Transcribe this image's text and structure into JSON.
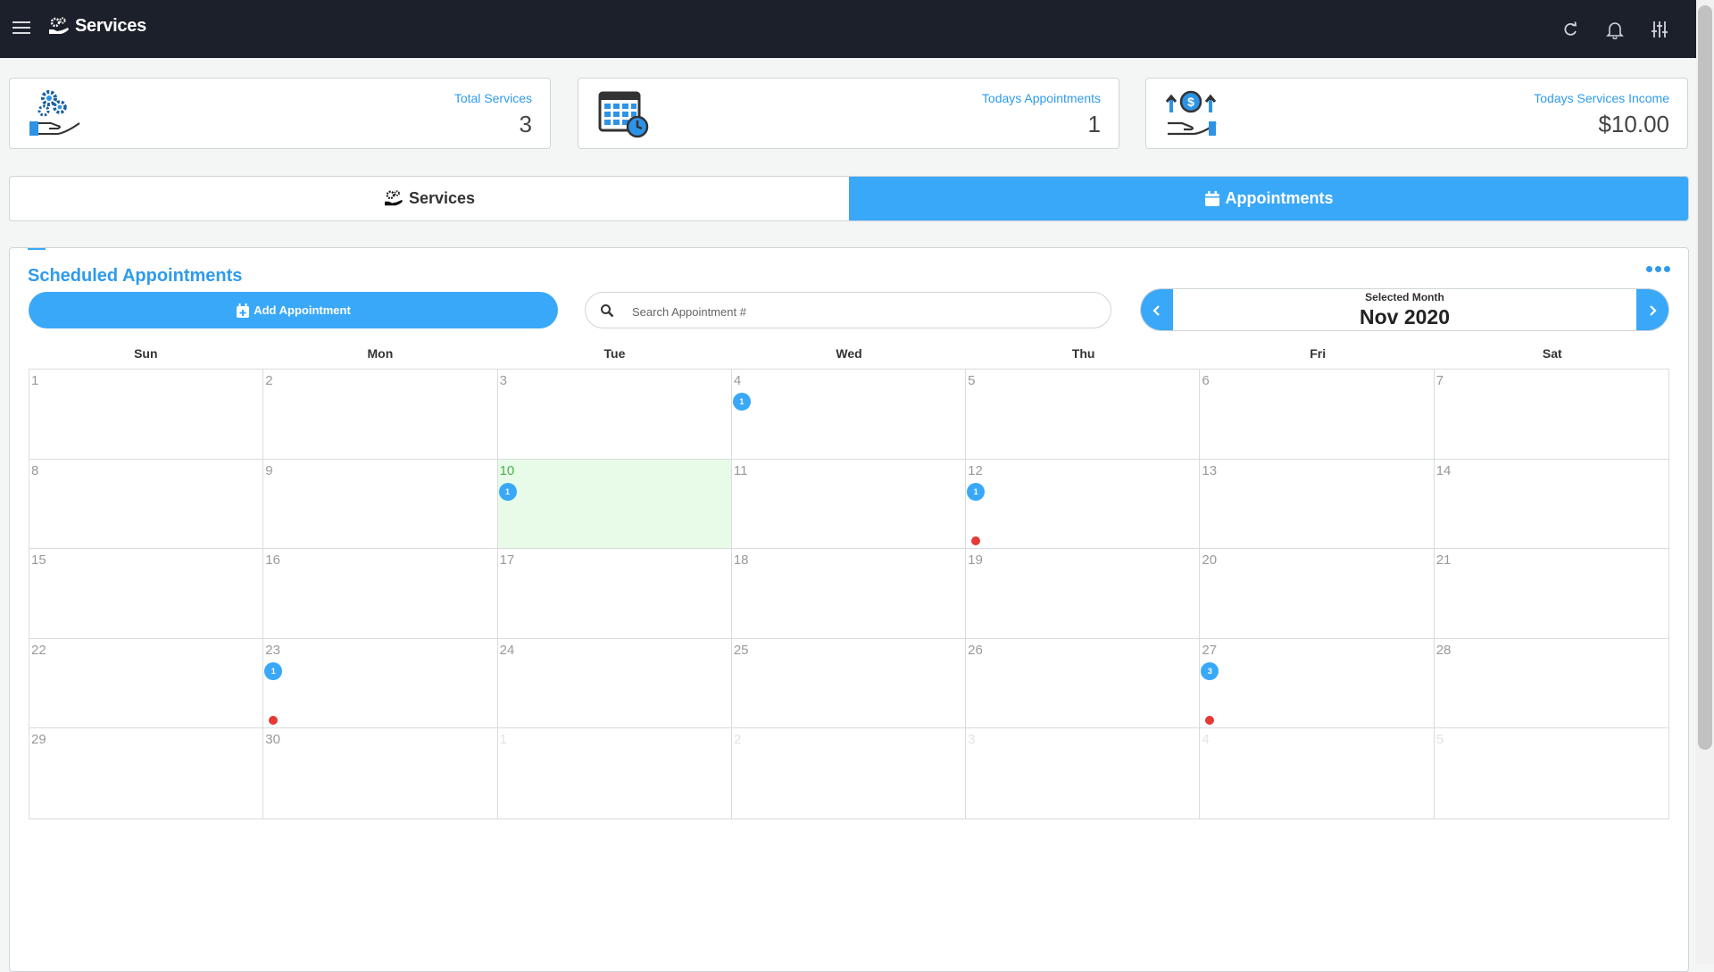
{
  "header": {
    "title": "Services"
  },
  "stats": [
    {
      "label": "Total Services",
      "value": "3"
    },
    {
      "label": "Todays Appointments",
      "value": "1"
    },
    {
      "label": "Todays Services Income",
      "value": "$10.00"
    }
  ],
  "tabs": [
    {
      "label": "Services",
      "active": false
    },
    {
      "label": "Appointments",
      "active": true
    }
  ],
  "appointments": {
    "title": "Scheduled Appointments",
    "add_label": "Add Appointment",
    "search_placeholder": "Search Appointment #",
    "search_value": "",
    "month_label": "Selected Month",
    "month_value": "Nov 2020"
  },
  "calendar": {
    "weekdays": [
      "Sun",
      "Mon",
      "Tue",
      "Wed",
      "Thu",
      "Fri",
      "Sat"
    ],
    "days": [
      {
        "d": "1"
      },
      {
        "d": "2"
      },
      {
        "d": "3"
      },
      {
        "d": "4",
        "count": "1"
      },
      {
        "d": "5"
      },
      {
        "d": "6"
      },
      {
        "d": "7"
      },
      {
        "d": "8"
      },
      {
        "d": "9"
      },
      {
        "d": "10",
        "count": "1",
        "today": true
      },
      {
        "d": "11"
      },
      {
        "d": "12",
        "count": "1",
        "dot": true
      },
      {
        "d": "13"
      },
      {
        "d": "14"
      },
      {
        "d": "15"
      },
      {
        "d": "16"
      },
      {
        "d": "17"
      },
      {
        "d": "18"
      },
      {
        "d": "19"
      },
      {
        "d": "20"
      },
      {
        "d": "21"
      },
      {
        "d": "22"
      },
      {
        "d": "23",
        "count": "1",
        "dot": true
      },
      {
        "d": "24"
      },
      {
        "d": "25"
      },
      {
        "d": "26"
      },
      {
        "d": "27",
        "count": "3",
        "dot": true
      },
      {
        "d": "28"
      },
      {
        "d": "29"
      },
      {
        "d": "30"
      },
      {
        "d": "1",
        "other": true
      },
      {
        "d": "2",
        "other": true
      },
      {
        "d": "3",
        "other": true
      },
      {
        "d": "4",
        "other": true
      },
      {
        "d": "5",
        "other": true
      }
    ]
  },
  "colors": {
    "accent": "#3aa8f8",
    "topbar": "#1b202a",
    "today": "#e8fbe8",
    "alert_dot": "#e53935"
  },
  "icons": [
    "menu-icon",
    "services-icon",
    "refresh-icon",
    "bell-icon",
    "sliders-icon",
    "gears-hand-icon",
    "calendar-clock-icon",
    "money-hand-icon",
    "calendar-plus-icon",
    "search-icon",
    "chevron-left-icon",
    "chevron-right-icon"
  ]
}
